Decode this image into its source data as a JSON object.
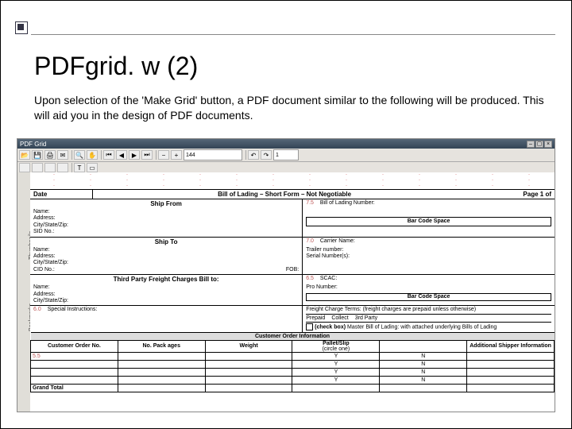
{
  "slide": {
    "title": "PDFgrid. w (2)",
    "body": "Upon selection of the 'Make Grid' button, a PDF document similar to the following will be produced.  This will aid you in the design of PDF documents."
  },
  "app": {
    "window_title": "PDF Grid",
    "close": "×",
    "toolbar": {
      "page": "144",
      "zoom": "1"
    },
    "vtabs": {
      "a": "Thumbnails",
      "b": "Bookmarks"
    }
  },
  "bol": {
    "title": "Bill of Lading – Short Form – Not Negotiable",
    "page": "Page 1 of",
    "date": "Date",
    "ship_from_h": "Ship From",
    "ship_to_h": "Ship To",
    "labels": {
      "name": "Name:",
      "address": "Address:",
      "csz": "City/State/Zip:",
      "sid": "SID No.:",
      "cid": "CID No.:",
      "fob": "FOB:"
    },
    "bol_no": "Bill of Lading Number:",
    "barcode1": "Bar Code Space",
    "carrier": "Carrier Name:",
    "trailer": "Trailer number:",
    "seal": "Serial Number(s):",
    "scac": "SCAC:",
    "pro": "Pro Number:",
    "barcode2": "Bar Code Space",
    "third": "Third Party Freight Charges Bill to:",
    "special": "Special Instructions:",
    "freight_terms": "Freight Charge Terms: (freight charges are prepaid unless otherwise)",
    "prepaid": "Prepaid",
    "collect": "Collect",
    "thirdparty": "3rd Party",
    "mb_check": "(check box)",
    "mb_text": "Master Bill of Lading: with attached underlying Bills of Lading",
    "coi_h": "Customer Order Information",
    "cols": {
      "order": "Customer Order No.",
      "pkg": "No. Pack ages",
      "weight": "Weight",
      "pallet": "Pallet/Slip",
      "pallet_sub": "(circle one)",
      "addl": "Additional Shipper Information"
    },
    "yn": {
      "y": "Y",
      "n": "N"
    },
    "grand": "Grand Total"
  },
  "ruler": {
    "y": [
      "7.5",
      "7.0",
      "6.5",
      "6.0",
      "5.5"
    ]
  }
}
